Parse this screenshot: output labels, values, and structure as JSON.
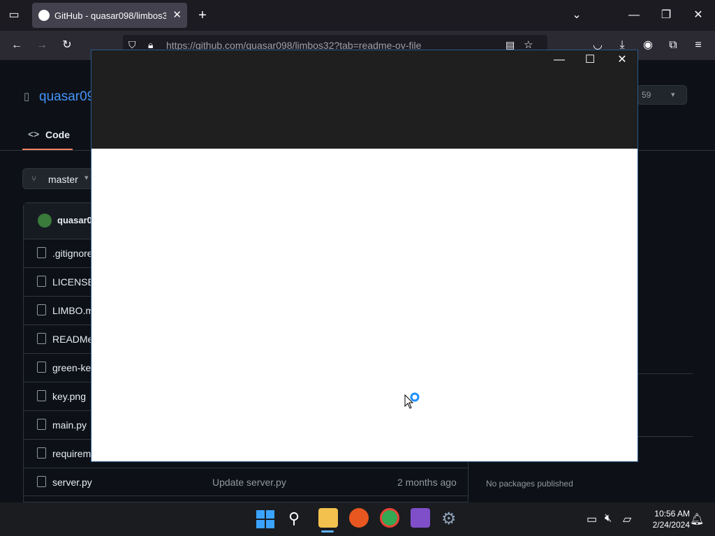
{
  "browser": {
    "tab_title": "GitHub - quasar098/limbos32: ",
    "url": "https://github.com/quasar098/limbos32?tab=readme-ov-file",
    "new_tab": "+",
    "tab_close": "✕"
  },
  "github": {
    "repo_owner": "quasar09",
    "nav_code": "Code",
    "branch": "master",
    "star_count": "59",
    "commit_user": "quasar0",
    "files": [
      {
        "name": ".gitignore"
      },
      {
        "name": "LICENSE"
      },
      {
        "name": "LIMBO.m"
      },
      {
        "name": "READMe"
      },
      {
        "name": "green-ke"
      },
      {
        "name": "key.png"
      },
      {
        "name": "main.py"
      },
      {
        "name": "requirem"
      },
      {
        "name": "server.py",
        "message": "Update server.py",
        "time": "2 months ago"
      }
    ],
    "packages": "No packages published"
  },
  "dialog": {
    "min": "—",
    "max": "☐",
    "close": "✕"
  },
  "taskbar": {
    "time": "10:56 AM",
    "date": "2/24/2024"
  },
  "colors": {
    "accent": "#4493f8",
    "dialog_header": "#1f1f1f",
    "dialog_body": "#ffffff",
    "tab_underline": "#f78166"
  }
}
